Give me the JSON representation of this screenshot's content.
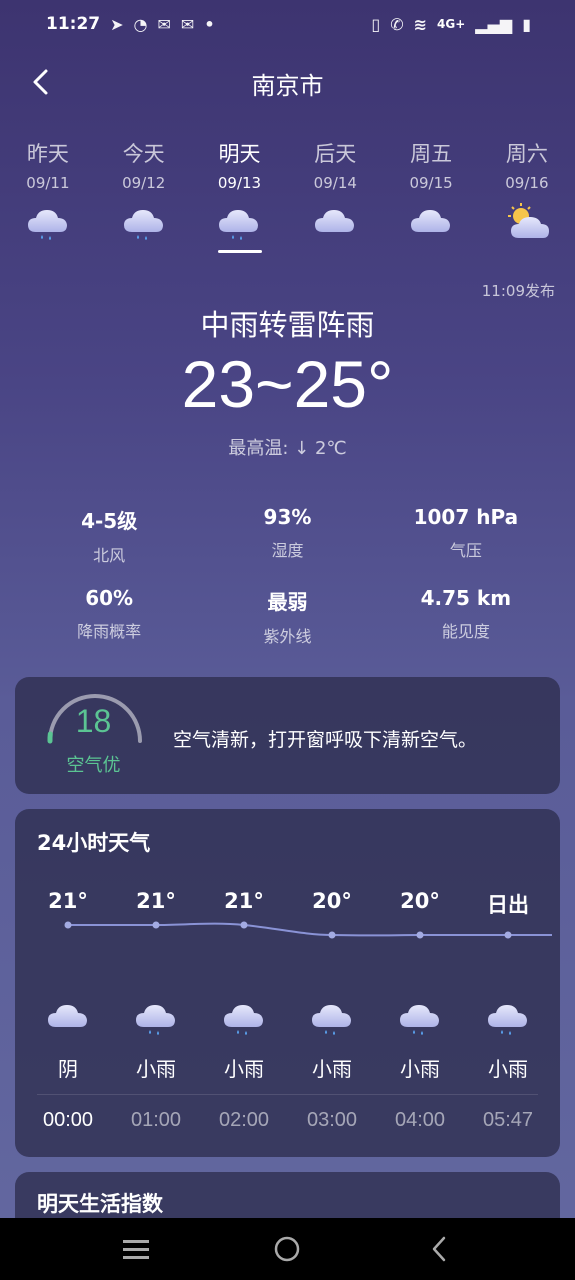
{
  "status_bar": {
    "time": "11:27",
    "left_icons": [
      "telegram-icon",
      "speedometer-icon",
      "mail-icon",
      "mail-icon",
      "dot-icon"
    ],
    "network": "4G+",
    "right_icons": [
      "vibrate-icon",
      "wifi-call-icon",
      "wifi-icon",
      "signal-icon",
      "battery-icon"
    ]
  },
  "header": {
    "city": "南京市"
  },
  "days": [
    {
      "name": "昨天",
      "date": "09/11",
      "icon": "rain-cloud-icon"
    },
    {
      "name": "今天",
      "date": "09/12",
      "icon": "rain-cloud-icon"
    },
    {
      "name": "明天",
      "date": "09/13",
      "icon": "rain-cloud-icon",
      "selected": true
    },
    {
      "name": "后天",
      "date": "09/14",
      "icon": "cloud-icon"
    },
    {
      "name": "周五",
      "date": "09/15",
      "icon": "cloud-icon"
    },
    {
      "name": "周六",
      "date": "09/16",
      "icon": "partly-sunny-icon"
    }
  ],
  "forecast": {
    "published": "11:09发布",
    "condition": "中雨转雷阵雨",
    "temp_range": "23~25°",
    "max_temp_change": "最高温: ↓ 2℃"
  },
  "details": [
    {
      "value": "4-5级",
      "label": "北风"
    },
    {
      "value": "93%",
      "label": "湿度"
    },
    {
      "value": "1007 hPa",
      "label": "气压"
    },
    {
      "value": "60%",
      "label": "降雨概率"
    },
    {
      "value": "最弱",
      "label": "紫外线"
    },
    {
      "value": "4.75 km",
      "label": "能见度"
    }
  ],
  "air_quality": {
    "value": "18",
    "level": "空气优",
    "message": "空气清新，打开窗呼吸下清新空气。",
    "color": "#5bc493"
  },
  "hourly": {
    "title": "24小时天气",
    "items": [
      {
        "temp": "21°",
        "cond": "阴",
        "time": "00:00",
        "icon": "cloud-icon",
        "now": true
      },
      {
        "temp": "21°",
        "cond": "小雨",
        "time": "01:00",
        "icon": "rain-cloud-icon"
      },
      {
        "temp": "21°",
        "cond": "小雨",
        "time": "02:00",
        "icon": "rain-cloud-icon"
      },
      {
        "temp": "20°",
        "cond": "小雨",
        "time": "03:00",
        "icon": "rain-cloud-icon"
      },
      {
        "temp": "20°",
        "cond": "小雨",
        "time": "04:00",
        "icon": "rain-cloud-icon"
      },
      {
        "temp": "日出",
        "cond": "小雨",
        "time": "05:47",
        "icon": "rain-cloud-icon"
      }
    ]
  },
  "life_index": {
    "title": "明天生活指数"
  },
  "nav": [
    "menu-icon",
    "home-icon",
    "back-icon"
  ]
}
